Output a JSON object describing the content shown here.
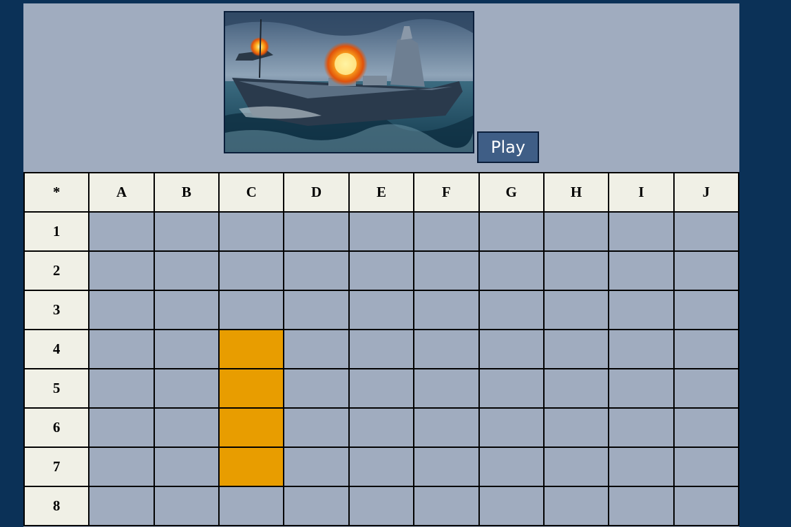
{
  "header": {
    "banner_alt": "Battleship game artwork",
    "play_label": "Play"
  },
  "board": {
    "corner_label": "*",
    "columns": [
      "A",
      "B",
      "C",
      "D",
      "E",
      "F",
      "G",
      "H",
      "I",
      "J"
    ],
    "rows": [
      "1",
      "2",
      "3",
      "4",
      "5",
      "6",
      "7",
      "8"
    ],
    "ship_cells": [
      "C4",
      "C5",
      "C6",
      "C7"
    ]
  },
  "colors": {
    "page_background": "#0b3157",
    "panel": "#a0acbf",
    "header_cell": "#f0f0e6",
    "ship": "#e89d00",
    "button": "#3f5e86"
  }
}
